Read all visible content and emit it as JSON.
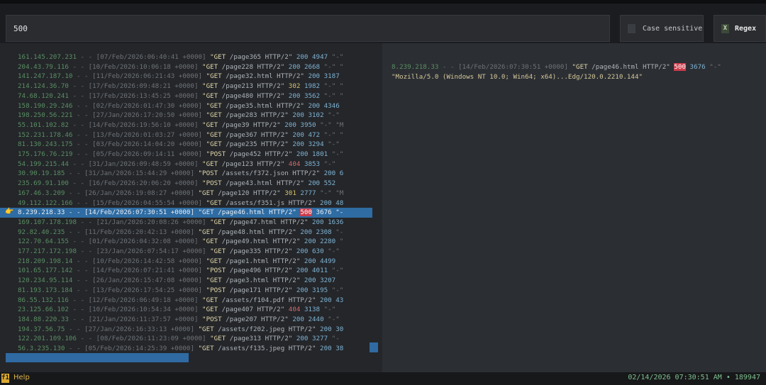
{
  "search": {
    "value": "500"
  },
  "options": {
    "case_sensitive": {
      "label": "Case sensitive",
      "box": "X",
      "checked": false
    },
    "regex": {
      "label": "Regex",
      "box": "X",
      "checked": true
    }
  },
  "marker": "👉",
  "logs": [
    {
      "ip": "161.145.207.231",
      "date": "[07/Feb/2026:06:40:41 +0000]",
      "verb": "\"GET",
      "path": "/page365 HTTP/2\"",
      "status": "200",
      "size": "4947",
      "tail": "\"-\""
    },
    {
      "ip": "204.43.79.116",
      "date": "[10/Feb/2026:10:06:18 +0000]",
      "verb": "\"GET",
      "path": "/page228 HTTP/2\"",
      "status": "200",
      "size": "2668",
      "tail": "\"-\" \""
    },
    {
      "ip": "141.247.187.10",
      "date": "[11/Feb/2026:06:21:43 +0000]",
      "verb": "\"GET",
      "path": "/page32.html HTTP/2\"",
      "status": "200",
      "size": "3187",
      "tail": ""
    },
    {
      "ip": "214.124.36.70",
      "date": "[17/Feb/2026:09:48:21 +0000]",
      "verb": "\"GET",
      "path": "/page213 HTTP/2\"",
      "status": "302",
      "size": "1982",
      "tail": "\"-\" \""
    },
    {
      "ip": "74.68.120.241",
      "date": "[17/Feb/2026:13:45:25 +0000]",
      "verb": "\"GET",
      "path": "/page480 HTTP/2\"",
      "status": "200",
      "size": "3562",
      "tail": "\"-\" \""
    },
    {
      "ip": "158.190.29.246",
      "date": "[02/Feb/2026:01:47:30 +0000]",
      "verb": "\"GET",
      "path": "/page35.html HTTP/2\"",
      "status": "200",
      "size": "4346",
      "tail": ""
    },
    {
      "ip": "198.250.56.221",
      "date": "[27/Jan/2026:17:20:50 +0000]",
      "verb": "\"GET",
      "path": "/page283 HTTP/2\"",
      "status": "200",
      "size": "3102",
      "tail": "\"-\""
    },
    {
      "ip": "55.101.102.82",
      "date": "[14/Feb/2026:19:56:10 +0000]",
      "verb": "\"GET",
      "path": "/page39 HTTP/2\"",
      "status": "200",
      "size": "3950",
      "tail": "\"-\" \"M"
    },
    {
      "ip": "152.231.178.46",
      "date": "[13/Feb/2026:01:03:27 +0000]",
      "verb": "\"GET",
      "path": "/page367 HTTP/2\"",
      "status": "200",
      "size": "472",
      "tail": "\"-\" \""
    },
    {
      "ip": "81.130.243.175",
      "date": "[03/Feb/2026:14:04:20 +0000]",
      "verb": "\"GET",
      "path": "/page235 HTTP/2\"",
      "status": "200",
      "size": "3294",
      "tail": "\"-\""
    },
    {
      "ip": "175.176.76.219",
      "date": "[05/Feb/2026:09:14:11 +0000]",
      "verb": "\"POST",
      "path": "/page452 HTTP/2\"",
      "status": "200",
      "size": "1801",
      "tail": "\"-\""
    },
    {
      "ip": "54.199.215.44",
      "date": "[31/Jan/2026:09:48:59 +0000]",
      "verb": "\"GET",
      "path": "/page123 HTTP/2\"",
      "status": "404",
      "size": "3853",
      "tail": "\"-\""
    },
    {
      "ip": "30.90.19.185",
      "date": "[31/Jan/2026:15:44:29 +0000]",
      "verb": "\"POST",
      "path": "/assets/f372.json HTTP/2\"",
      "status": "200",
      "size": "6",
      "tail": ""
    },
    {
      "ip": "235.69.91.100",
      "date": "[16/Feb/2026:20:06:20 +0000]",
      "verb": "\"POST",
      "path": "/page43.html HTTP/2\"",
      "status": "200",
      "size": "552",
      "tail": ""
    },
    {
      "ip": "167.46.3.209",
      "date": "[26/Jan/2026:19:08:27 +0000]",
      "verb": "\"GET",
      "path": "/page120 HTTP/2\"",
      "status": "301",
      "size": "2777",
      "tail": "\"-\" \"M"
    },
    {
      "ip": "49.112.122.166",
      "date": "[15/Feb/2026:04:55:54 +0000]",
      "verb": "\"GET",
      "path": "/assets/f351.js HTTP/2\"",
      "status": "200",
      "size": "48",
      "tail": ""
    },
    {
      "ip": "8.239.218.33",
      "date": "[14/Feb/2026:07:30:51 +0000]",
      "verb": "\"GET",
      "path": "/page46.html HTTP/2\"",
      "status": "500",
      "size": "3676",
      "tail": "\"-"
    },
    {
      "ip": "169.107.178.198",
      "date": "[21/Jan/2026:20:08:26 +0000]",
      "verb": "\"GET",
      "path": "/page47.html HTTP/2\"",
      "status": "200",
      "size": "1636",
      "tail": ""
    },
    {
      "ip": "92.82.40.235",
      "date": "[11/Feb/2026:20:42:13 +0000]",
      "verb": "\"GET",
      "path": "/page48.html HTTP/2\"",
      "status": "200",
      "size": "2308",
      "tail": "\"-"
    },
    {
      "ip": "122.70.64.155",
      "date": "[01/Feb/2026:04:32:08 +0000]",
      "verb": "\"GET",
      "path": "/page49.html HTTP/2\"",
      "status": "200",
      "size": "2280",
      "tail": "\""
    },
    {
      "ip": "177.217.172.198",
      "date": "[23/Jan/2026:07:54:17 +0000]",
      "verb": "\"GET",
      "path": "/page335 HTTP/2\"",
      "status": "200",
      "size": "630",
      "tail": "\"-\""
    },
    {
      "ip": "218.209.198.14",
      "date": "[10/Feb/2026:14:42:58 +0000]",
      "verb": "\"GET",
      "path": "/page1.html HTTP/2\"",
      "status": "200",
      "size": "4499",
      "tail": ""
    },
    {
      "ip": "101.65.177.142",
      "date": "[14/Feb/2026:07:21:41 +0000]",
      "verb": "\"POST",
      "path": "/page496 HTTP/2\"",
      "status": "200",
      "size": "4011",
      "tail": "\"-\""
    },
    {
      "ip": "120.234.95.114",
      "date": "[26/Jan/2026:15:47:08 +0000]",
      "verb": "\"GET",
      "path": "/page3.html HTTP/2\"",
      "status": "200",
      "size": "3207",
      "tail": ""
    },
    {
      "ip": "81.193.173.184",
      "date": "[13/Feb/2026:17:54:25 +0000]",
      "verb": "\"POST",
      "path": "/page171 HTTP/2\"",
      "status": "200",
      "size": "3195",
      "tail": "\"-\""
    },
    {
      "ip": "86.55.132.116",
      "date": "[12/Feb/2026:06:49:18 +0000]",
      "verb": "\"GET",
      "path": "/assets/f104.pdf HTTP/2\"",
      "status": "200",
      "size": "43",
      "tail": ""
    },
    {
      "ip": "23.125.66.102",
      "date": "[10/Feb/2026:10:54:34 +0000]",
      "verb": "\"GET",
      "path": "/page407 HTTP/2\"",
      "status": "404",
      "size": "3138",
      "tail": "\"-\""
    },
    {
      "ip": "184.88.220.33",
      "date": "[21/Jan/2026:11:37:57 +0000]",
      "verb": "\"POST",
      "path": "/page207 HTTP/2\"",
      "status": "200",
      "size": "2440",
      "tail": "\"-\""
    },
    {
      "ip": "194.37.56.75",
      "date": "[27/Jan/2026:16:33:13 +0000]",
      "verb": "\"GET",
      "path": "/assets/f202.jpeg HTTP/2\"",
      "status": "200",
      "size": "30",
      "tail": ""
    },
    {
      "ip": "122.201.109.106",
      "date": "[08/Feb/2026:11:23:09 +0000]",
      "verb": "\"GET",
      "path": "/page313 HTTP/2\"",
      "status": "200",
      "size": "3277",
      "tail": "\"-"
    },
    {
      "ip": "56.3.235.130",
      "date": "[05/Feb/2026:14:25:39 +0000]",
      "verb": "\"GET",
      "path": "/assets/f135.jpeg HTTP/2\"",
      "status": "200",
      "size": "38",
      "tail": ""
    }
  ],
  "selected_index": 16,
  "detail": {
    "ip": "8.239.218.33",
    "date": "- - [14/Feb/2026:07:30:51 +0000]",
    "verb": "\"GET",
    "path": "/page46.html HTTP/2\"",
    "status": "500",
    "size": "3676",
    "tail": "\"-\"",
    "agent": "\"Mozilla/5.0 (Windows NT 10.0; Win64; x64)...Edg/120.0.2210.144\""
  },
  "statusbar": {
    "help_key": "f1",
    "help_label": "Help",
    "timestamp": "02/14/2026 07:30:51 AM",
    "separator": "•",
    "count": "189947"
  },
  "colors": {
    "selection": "#2e6ca3",
    "match": "#cc3b4a",
    "accent": "#d9a931"
  }
}
